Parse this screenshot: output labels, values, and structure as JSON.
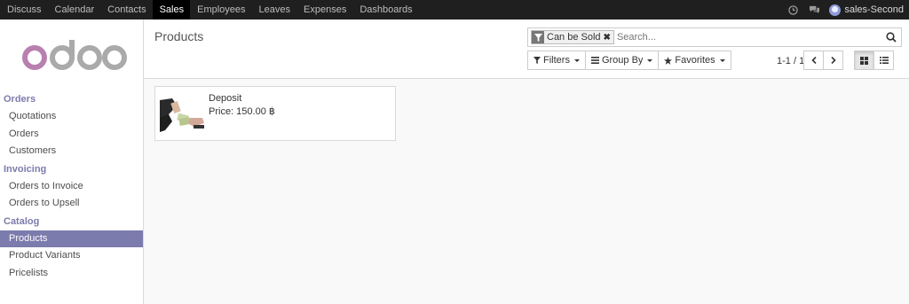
{
  "topbar": {
    "menu": [
      "Discuss",
      "Calendar",
      "Contacts",
      "Sales",
      "Employees",
      "Leaves",
      "Expenses",
      "Dashboards"
    ],
    "active_menu": "Sales",
    "icons": [
      "clock-icon",
      "chat-icon"
    ],
    "user_name": "sales-Second"
  },
  "sidebar": {
    "logo_text": "odoo",
    "sections": [
      {
        "header": "Orders",
        "items": [
          "Quotations",
          "Orders",
          "Customers"
        ]
      },
      {
        "header": "Invoicing",
        "items": [
          "Orders to Invoice",
          "Orders to Upsell"
        ]
      },
      {
        "header": "Catalog",
        "items": [
          "Products",
          "Product Variants",
          "Pricelists"
        ]
      }
    ],
    "active_item": "Products"
  },
  "control_panel": {
    "title": "Products",
    "search": {
      "facet_label": "Can be Sold",
      "placeholder": "Search..."
    },
    "buttons": {
      "filters": "Filters",
      "group_by": "Group By",
      "favorites": "Favorites"
    },
    "pager": "1-1 / 1",
    "active_view": "kanban"
  },
  "products": [
    {
      "name": "Deposit",
      "price": "Price: 150.00 ฿"
    }
  ],
  "colors": {
    "topbar": "#1f1f1f",
    "accent": "#7c7bad",
    "logo": "#b880b0"
  }
}
